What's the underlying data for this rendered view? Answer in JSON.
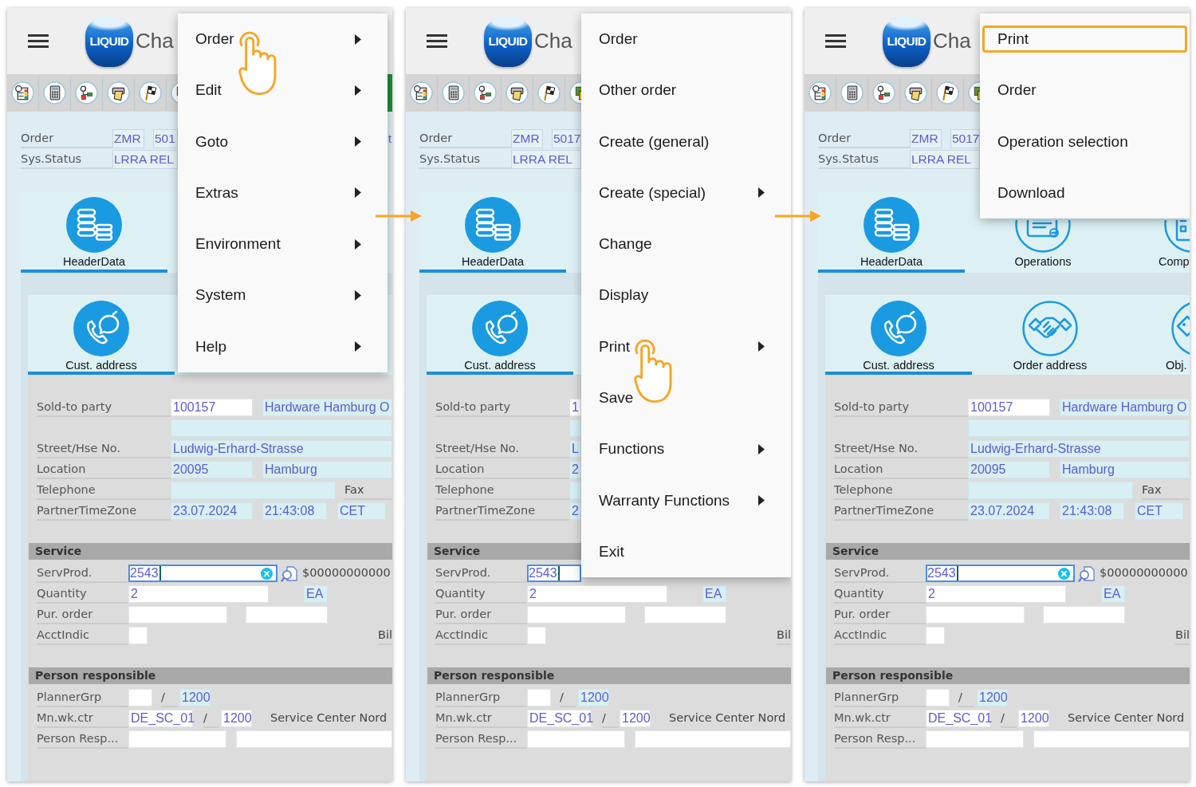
{
  "panels": [
    {
      "header": {
        "logo": "LIQUID",
        "title": "Cha"
      },
      "toolbar": [
        {
          "kind": "table"
        },
        {
          "kind": "calculator"
        },
        {
          "kind": "workflow"
        },
        {
          "kind": "printer"
        },
        {
          "kind": "flag"
        },
        {
          "kind": "documents"
        },
        {
          "kind": "status"
        }
      ],
      "key_fields": [
        {
          "label": "Order",
          "values": [
            "ZMR",
            "501"
          ],
          "tail": "t"
        },
        {
          "label": "Sys.Status",
          "values": [
            "LRRA REL"
          ]
        }
      ],
      "tiles": [
        [
          {
            "kind": "header",
            "label": "HeaderData",
            "selected": true
          }
        ],
        [
          {
            "kind": "address",
            "label": "Cust. address",
            "selected": true
          }
        ]
      ],
      "address": [
        {
          "label": "Sold-to party",
          "items": [
            {
              "kind": "field",
              "value": "100157",
              "editable": true
            },
            {
              "kind": "field",
              "value": "Hardware Hamburg O",
              "editable": false
            }
          ]
        },
        {
          "items": [
            {
              "kind": "field",
              "editable": false
            }
          ]
        },
        {
          "label": "Street/Hse No.",
          "items": [
            {
              "kind": "field",
              "value": "Ludwig-Erhard-Strasse",
              "editable": false
            }
          ]
        },
        {
          "label": "Location",
          "items": [
            {
              "kind": "field",
              "value": "20095",
              "editable": false
            },
            {
              "kind": "field",
              "value": "Hamburg",
              "editable": false
            }
          ]
        },
        {
          "label": "Telephone",
          "items": [
            {
              "kind": "field",
              "editable": false
            },
            {
              "kind": "text",
              "text": "Fax"
            }
          ]
        },
        {
          "label": "PartnerTimeZone",
          "items": [
            {
              "kind": "field",
              "value": "23.07.2024",
              "editable": false
            },
            {
              "kind": "field",
              "value": "21:43:08",
              "editable": false
            },
            {
              "kind": "field",
              "value": "CET",
              "editable": false
            }
          ]
        }
      ],
      "sections": [
        {
          "title": "Service",
          "rows": [
            {
              "label": "ServProd.",
              "items": [
                {
                  "kind": "field",
                  "value": "2543",
                  "editable": true,
                  "focused": true
                },
                {
                  "kind": "search"
                },
                {
                  "kind": "text",
                  "text": "$00000000000"
                }
              ]
            },
            {
              "label": "Quantity",
              "items": [
                {
                  "kind": "field",
                  "value": "2",
                  "editable": true
                },
                {
                  "kind": "field",
                  "value": "EA",
                  "editable": false
                }
              ]
            },
            {
              "label": "Pur. order",
              "items": [
                {
                  "kind": "field",
                  "editable": true
                },
                {
                  "kind": "field",
                  "editable": true
                }
              ]
            },
            {
              "label": "AcctIndic",
              "items": [
                {
                  "kind": "field",
                  "editable": true
                },
                {
                  "kind": "text",
                  "text": "Bil"
                }
              ]
            }
          ]
        },
        {
          "title": "Person responsible",
          "rows": [
            {
              "label": "PlannerGrp",
              "items": [
                {
                  "kind": "field",
                  "editable": true
                },
                {
                  "kind": "text",
                  "text": "/"
                },
                {
                  "kind": "field",
                  "value": "1200",
                  "editable": false
                }
              ]
            },
            {
              "label": "Mn.wk.ctr",
              "items": [
                {
                  "kind": "field",
                  "value": "DE_SC_01",
                  "editable": true
                },
                {
                  "kind": "text",
                  "text": "/"
                },
                {
                  "kind": "field",
                  "value": "1200",
                  "editable": true
                },
                {
                  "kind": "text",
                  "text": "Service Center Nord"
                }
              ]
            },
            {
              "label": "Person Resp...",
              "items": [
                {
                  "kind": "field",
                  "editable": true
                },
                {
                  "kind": "field",
                  "editable": true
                }
              ]
            }
          ]
        }
      ],
      "menu": {
        "items": [
          {
            "label": "Order",
            "submenu": true,
            "tapped": true
          },
          {
            "label": "Edit",
            "submenu": true,
            "tapped": false
          },
          {
            "label": "Goto",
            "submenu": true,
            "tapped": false
          },
          {
            "label": "Extras",
            "submenu": true,
            "tapped": false
          },
          {
            "label": "Environment",
            "submenu": true,
            "tapped": false
          },
          {
            "label": "System",
            "submenu": true,
            "tapped": false
          },
          {
            "label": "Help",
            "submenu": true,
            "tapped": false
          }
        ]
      }
    },
    {
      "header": {
        "logo": "LIQUID",
        "title": "Cha"
      },
      "toolbar": [
        {
          "kind": "table"
        },
        {
          "kind": "calculator"
        },
        {
          "kind": "workflow"
        },
        {
          "kind": "printer"
        },
        {
          "kind": "flag"
        },
        {
          "kind": "documents"
        }
      ],
      "key_fields": [
        {
          "label": "Order",
          "values": [
            "ZMR",
            "5017"
          ]
        },
        {
          "label": "Sys.Status",
          "values": [
            "LRRA REL"
          ]
        }
      ],
      "tiles": [
        [
          {
            "kind": "header",
            "label": "HeaderData",
            "selected": true
          }
        ],
        [
          {
            "kind": "address",
            "label": "Cust. address",
            "selected": true
          }
        ]
      ],
      "address": [
        {
          "label": "Sold-to party",
          "items": [
            {
              "kind": "field",
              "value": "1",
              "editable": true
            }
          ]
        },
        {
          "items": [
            {
              "kind": "field",
              "editable": false
            }
          ]
        },
        {
          "label": "Street/Hse No.",
          "items": [
            {
              "kind": "field",
              "value": "L",
              "editable": false
            }
          ]
        },
        {
          "label": "Location",
          "items": [
            {
              "kind": "field",
              "value": "2",
              "editable": false
            }
          ]
        },
        {
          "label": "Telephone",
          "items": [
            {
              "kind": "field",
              "editable": false
            }
          ]
        },
        {
          "label": "PartnerTimeZone",
          "items": [
            {
              "kind": "field",
              "value": "2",
              "editable": false
            }
          ]
        }
      ],
      "sections": [
        {
          "title": "Service",
          "rows": [
            {
              "label": "ServProd.",
              "items": [
                {
                  "kind": "field",
                  "value": "2543",
                  "editable": true,
                  "focused": true
                }
              ]
            },
            {
              "label": "Quantity",
              "items": [
                {
                  "kind": "field",
                  "value": "2",
                  "editable": true
                },
                {
                  "kind": "field",
                  "value": "EA",
                  "editable": false
                }
              ]
            },
            {
              "label": "Pur. order",
              "items": [
                {
                  "kind": "field",
                  "editable": true
                },
                {
                  "kind": "field",
                  "editable": true
                }
              ]
            },
            {
              "label": "AcctIndic",
              "items": [
                {
                  "kind": "field",
                  "editable": true
                },
                {
                  "kind": "text",
                  "text": "Bil"
                }
              ]
            }
          ]
        },
        {
          "title": "Person responsible",
          "rows": [
            {
              "label": "PlannerGrp",
              "items": [
                {
                  "kind": "field",
                  "editable": true
                },
                {
                  "kind": "text",
                  "text": "/"
                },
                {
                  "kind": "field",
                  "value": "1200",
                  "editable": false
                }
              ]
            },
            {
              "label": "Mn.wk.ctr",
              "items": [
                {
                  "kind": "field",
                  "value": "DE_SC_01",
                  "editable": true
                },
                {
                  "kind": "text",
                  "text": "/"
                },
                {
                  "kind": "field",
                  "value": "1200",
                  "editable": true
                },
                {
                  "kind": "text",
                  "text": "Service Center Nord"
                }
              ]
            },
            {
              "label": "Person Resp...",
              "items": [
                {
                  "kind": "field",
                  "editable": true
                },
                {
                  "kind": "field",
                  "editable": true
                }
              ]
            }
          ]
        }
      ],
      "menu": {
        "items": [
          {
            "label": "Order",
            "submenu": false,
            "tapped": false
          },
          {
            "label": "Other order",
            "submenu": false,
            "tapped": false
          },
          {
            "label": "Create (general)",
            "submenu": false,
            "tapped": false
          },
          {
            "label": "Create (special)",
            "submenu": true,
            "tapped": false
          },
          {
            "label": "Change",
            "submenu": false,
            "tapped": false
          },
          {
            "label": "Display",
            "submenu": false,
            "tapped": false
          },
          {
            "label": "Print",
            "submenu": true,
            "tapped": true
          },
          {
            "label": "Save",
            "submenu": false,
            "tapped": false
          },
          {
            "label": "Functions",
            "submenu": true,
            "tapped": false
          },
          {
            "label": "Warranty Functions",
            "submenu": true,
            "tapped": false
          },
          {
            "label": "Exit",
            "submenu": false,
            "tapped": false
          }
        ]
      }
    },
    {
      "header": {
        "logo": "LIQUID",
        "title": "Cha"
      },
      "toolbar": [
        {
          "kind": "table"
        },
        {
          "kind": "calculator"
        },
        {
          "kind": "workflow"
        },
        {
          "kind": "printer"
        },
        {
          "kind": "flag"
        },
        {
          "kind": "documents"
        }
      ],
      "key_fields": [
        {
          "label": "Order",
          "values": [
            "ZMR",
            "5017"
          ]
        },
        {
          "label": "Sys.Status",
          "values": [
            "LRRA REL"
          ]
        }
      ],
      "tiles": [
        [
          {
            "kind": "header",
            "label": "HeaderData",
            "selected": true
          },
          {
            "kind": "operations",
            "label": "Operations",
            "selected": false
          },
          {
            "kind": "components",
            "label": "Comp",
            "selected": false
          }
        ],
        [
          {
            "kind": "address",
            "label": "Cust. address",
            "selected": true
          },
          {
            "kind": "partner",
            "label": "Order address",
            "selected": false
          },
          {
            "kind": "object",
            "label": "Obj.",
            "selected": false
          }
        ]
      ],
      "address": [
        {
          "label": "Sold-to party",
          "items": [
            {
              "kind": "field",
              "value": "100157",
              "editable": true
            },
            {
              "kind": "field",
              "value": "Hardware Hamburg O",
              "editable": false
            }
          ]
        },
        {
          "items": [
            {
              "kind": "field",
              "editable": false
            }
          ]
        },
        {
          "label": "Street/Hse No.",
          "items": [
            {
              "kind": "field",
              "value": "Ludwig-Erhard-Strasse",
              "editable": false
            }
          ]
        },
        {
          "label": "Location",
          "items": [
            {
              "kind": "field",
              "value": "20095",
              "editable": false
            },
            {
              "kind": "field",
              "value": "Hamburg",
              "editable": false
            }
          ]
        },
        {
          "label": "Telephone",
          "items": [
            {
              "kind": "field",
              "editable": false
            },
            {
              "kind": "text",
              "text": "Fax"
            }
          ]
        },
        {
          "label": "PartnerTimeZone",
          "items": [
            {
              "kind": "field",
              "value": "23.07.2024",
              "editable": false
            },
            {
              "kind": "field",
              "value": "21:43:08",
              "editable": false
            },
            {
              "kind": "field",
              "value": "CET",
              "editable": false
            }
          ]
        }
      ],
      "sections": [
        {
          "title": "Service",
          "rows": [
            {
              "label": "ServProd.",
              "items": [
                {
                  "kind": "field",
                  "value": "2543",
                  "editable": true,
                  "focused": true
                },
                {
                  "kind": "search"
                },
                {
                  "kind": "text",
                  "text": "$00000000000"
                }
              ]
            },
            {
              "label": "Quantity",
              "items": [
                {
                  "kind": "field",
                  "value": "2",
                  "editable": true
                },
                {
                  "kind": "field",
                  "value": "EA",
                  "editable": false
                }
              ]
            },
            {
              "label": "Pur. order",
              "items": [
                {
                  "kind": "field",
                  "editable": true
                },
                {
                  "kind": "field",
                  "editable": true
                }
              ]
            },
            {
              "label": "AcctIndic",
              "items": [
                {
                  "kind": "field",
                  "editable": true
                },
                {
                  "kind": "text",
                  "text": "Bil"
                }
              ]
            }
          ]
        },
        {
          "title": "Person responsible",
          "rows": [
            {
              "label": "PlannerGrp",
              "items": [
                {
                  "kind": "field",
                  "editable": true
                },
                {
                  "kind": "text",
                  "text": "/"
                },
                {
                  "kind": "field",
                  "value": "1200",
                  "editable": false
                }
              ]
            },
            {
              "label": "Mn.wk.ctr",
              "items": [
                {
                  "kind": "field",
                  "value": "DE_SC_01",
                  "editable": true
                },
                {
                  "kind": "text",
                  "text": "/"
                },
                {
                  "kind": "field",
                  "value": "1200",
                  "editable": true
                },
                {
                  "kind": "text",
                  "text": "Service Center Nord"
                }
              ]
            },
            {
              "label": "Person Resp...",
              "items": [
                {
                  "kind": "field",
                  "editable": true
                },
                {
                  "kind": "field",
                  "editable": true
                }
              ]
            }
          ]
        }
      ],
      "menu": {
        "items": [
          {
            "label": "Print",
            "submenu": false,
            "highlighted": true
          },
          {
            "label": "Order",
            "submenu": false,
            "highlighted": false
          },
          {
            "label": "Operation selection",
            "submenu": false,
            "highlighted": false
          },
          {
            "label": "Download",
            "submenu": false,
            "highlighted": false
          }
        ]
      }
    }
  ]
}
